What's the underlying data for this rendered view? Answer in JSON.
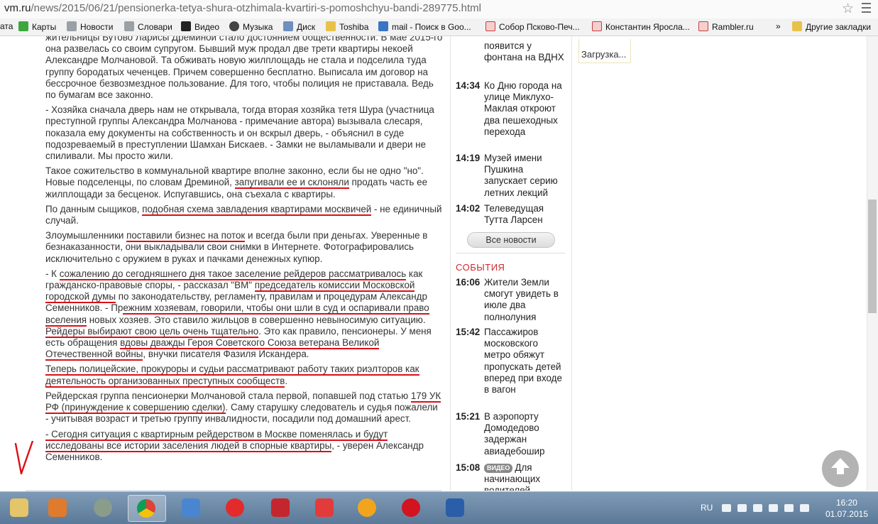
{
  "browser": {
    "url_host": "vm.ru",
    "url_path": "/news/2015/06/21/pensionerka-tetya-shura-otzhimala-kvartiri-s-pomoshchyu-bandi-289775.html",
    "bookmarks": [
      "ата",
      "Карты",
      "Новости",
      "Словари",
      "Видео",
      "Музыка",
      "Диск",
      "Toshiba",
      "mail - Поиск в Goo...",
      "Собор Псково-Печ...",
      "Константин Яросла...",
      "Rambler.ru",
      "»",
      "Другие закладки"
    ]
  },
  "article": {
    "p1": "жительницы Бутово Ларисы Дреминой стало достоянием общественности. В мае 2015-го она развелась со своим супругом. Бывший муж продал две трети квартиры некоей Александре Молчановой. Та обживать новую жилплощадь не стала и подселила туда группу бородатых чеченцев. Причем совершенно бесплатно. Выписала им договор на бессрочное безвозмездное пользование. Для того, чтобы полиция не приставала. Ведь по бумагам все законно.",
    "p2": "- Хозяйка сначала дверь нам не открывала, тогда вторая хозяйка тетя Шура (участница преступной группы Александра Молчанова - примечание автора) вызывала слесаря, показала ему документы на собственность и он вскрыл дверь, - объяснил в суде подозреваемый в преступлении Шамхан Бискаев. - Замки не выламывали и двери не спиливали. Мы просто жили.",
    "p3a": "Такое сожительство в коммунальной квартире вполне законно, если бы не одно \"но\". Новые подселенцы, по словам Дреминой, ",
    "p3u": "запугивали ее и склоняли",
    "p3b": " продать часть ее жилплощади за бесценок. Испугавшись, она съехала с квартиры.",
    "p4a": "По данным сыщиков, ",
    "p4u": "подобная схема завладения квартирами москвичей",
    "p4b": " - не единичный случай.",
    "p5a": "Злоумышленники ",
    "p5u": "поставили бизнес на поток",
    "p5b": " и всегда были при деньгах. Уверенные в безнаказанности, они выкладывали свои снимки в Интернете. Фотографировались исключительно с оружием в руках и пачками денежных купюр.",
    "p6a": "- К ",
    "p6u1": "сожалению до сегодняшнего дня такое заселение рейдеров рассматривалось",
    "p6b": " как гражданско-правовые споры, - рассказал \"ВМ\" ",
    "p6u2": "председатель комиссии Московской городской думы",
    "p6c": " по законодательству, регламенту, правилам и процедурам Александр Семенников. - Пр",
    "p6u3": "ежним хозяевам, говорили, чтобы они шли в суд и оспаривали право вселения",
    "p6d": " новых хозяев. Это ставило жильцов в совершенно невыносимую ситуацию. ",
    "p6u4": "Рейдеры выбирают свою цель очень тщательно",
    "p6e": ". Это как правило, пенсионеры. У меня есть обращения ",
    "p6u5": "вдовы дважды Героя Советского Союза ветерана Великой Отечественной войны",
    "p6f": ", внучки писателя Фазиля Искандера.",
    "p7u": "Теперь полицейские, прокуроры и судьи рассматривают работу таких риэлторов как деятельность организованных преступных сообществ",
    "p7b": ".",
    "p8a": "Рейдерская группа пенсионерки Молчановой стала первой, попавшей под статью ",
    "p8u": "179 УК РФ (принуждение к совершению сделки)",
    "p8b": ". Саму старушку следователь и судья пожалели - учитывая возраст и третью группу инвалидности, посадили под домашний арест.",
    "p9u": "- Сегодня ситуация с квартирным рейдерством в Москве поменялась и будут исследованы все истории заселения людей в спорные квартиры",
    "p9b": ", - уверен Александр Семенников."
  },
  "news": {
    "items": [
      {
        "time": "",
        "headline": "появится у фонтана на ВДНХ"
      },
      {
        "time": "14:34",
        "headline": "Ко Дню города на улице Миклухо-Маклая откроют два пешеходных перехода"
      },
      {
        "time": "14:19",
        "headline": "Музей имени Пушкина запускает серию летних лекций"
      },
      {
        "time": "14:02",
        "headline": "Телеведущая Тутта Ларсен"
      }
    ],
    "all_news_label": "Все новости",
    "events_title": "СОБЫТИЯ",
    "events": [
      {
        "time": "16:06",
        "headline": "Жители Земли смогут увидеть в июле два полнолуния"
      },
      {
        "time": "15:42",
        "headline": "Пассажиров московского метро обяжут пропускать детей вперед при входе в вагон"
      },
      {
        "time": "15:21",
        "headline": "В аэропорту Домодедово задержан авиадебошир"
      },
      {
        "time": "15:08",
        "video": "ВИДЕО",
        "headline": "Для начинающих водителей"
      }
    ]
  },
  "sidebar": {
    "loading": "Загрузка..."
  },
  "taskbar": {
    "lang": "RU",
    "time": "16:20",
    "date": "01.07.2015"
  },
  "colors": {
    "underline": "#dc0f17",
    "events": "#d1282e"
  }
}
